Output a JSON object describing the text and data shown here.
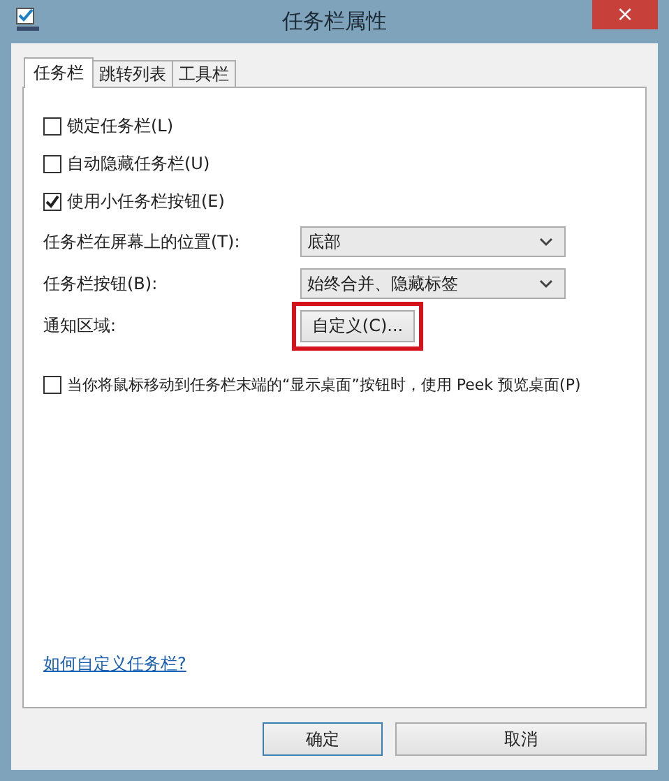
{
  "window": {
    "title": "任务栏属性",
    "close": "×"
  },
  "tabs": [
    {
      "label": "任务栏",
      "selected": true
    },
    {
      "label": "跳转列表",
      "selected": false
    },
    {
      "label": "工具栏",
      "selected": false
    }
  ],
  "options": [
    {
      "label": "锁定任务栏(L)",
      "checked": false
    },
    {
      "label": "自动隐藏任务栏(U)",
      "checked": false
    },
    {
      "label": "使用小任务栏按钮(E)",
      "checked": true
    }
  ],
  "settings": [
    {
      "kind": "select",
      "label": "任务栏在屏幕上的位置(T):",
      "value": "底部"
    },
    {
      "kind": "select",
      "label": "任务栏按钮(B):",
      "value": "始终合并、隐藏标签"
    },
    {
      "kind": "button",
      "label": "通知区域:",
      "value": "自定义(C)...",
      "highlighted": true
    }
  ],
  "peek_option": {
    "label": "当你将鼠标移动到任务栏末端的“显示桌面”按钮时，使用 Peek 预览桌面(P)",
    "checked": false
  },
  "help_link": "如何自定义任务栏?",
  "buttons": [
    {
      "label": "确定",
      "default": true
    },
    {
      "label": "取消",
      "default": false
    }
  ]
}
